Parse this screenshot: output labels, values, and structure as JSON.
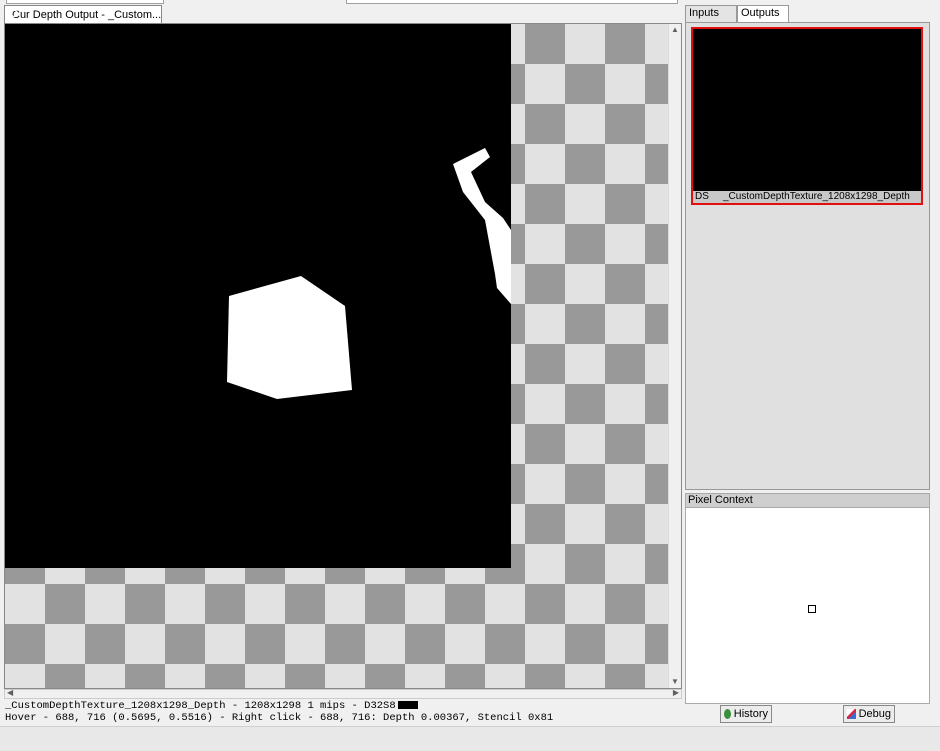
{
  "main_tab": {
    "title": "Cur Depth Output - _Custom...",
    "icon": "texture-viewer-icon"
  },
  "status": {
    "line1": "_CustomDepthTexture_1208x1298_Depth - 1208x1298 1 mips - D32S8",
    "line2": "Hover -   688,  716 (0.5695, 0.5516)  - Right click -   688,  716: Depth 0.00367, Stencil 0x81"
  },
  "right_tabs": {
    "inputs": "Inputs",
    "outputs": "Outputs"
  },
  "outputs": {
    "thumb_type": "DS",
    "thumb_name": "_CustomDepthTexture_1208x1298_Depth",
    "selected_border_color": "#e01010"
  },
  "pixel_context": {
    "title": "Pixel Context",
    "history_label": "History",
    "debug_label": "Debug"
  },
  "colors": {
    "checker_dark": "#999999",
    "checker_light": "#e2e2e2",
    "depth_background": "#000000",
    "depth_shape": "#ffffff"
  }
}
